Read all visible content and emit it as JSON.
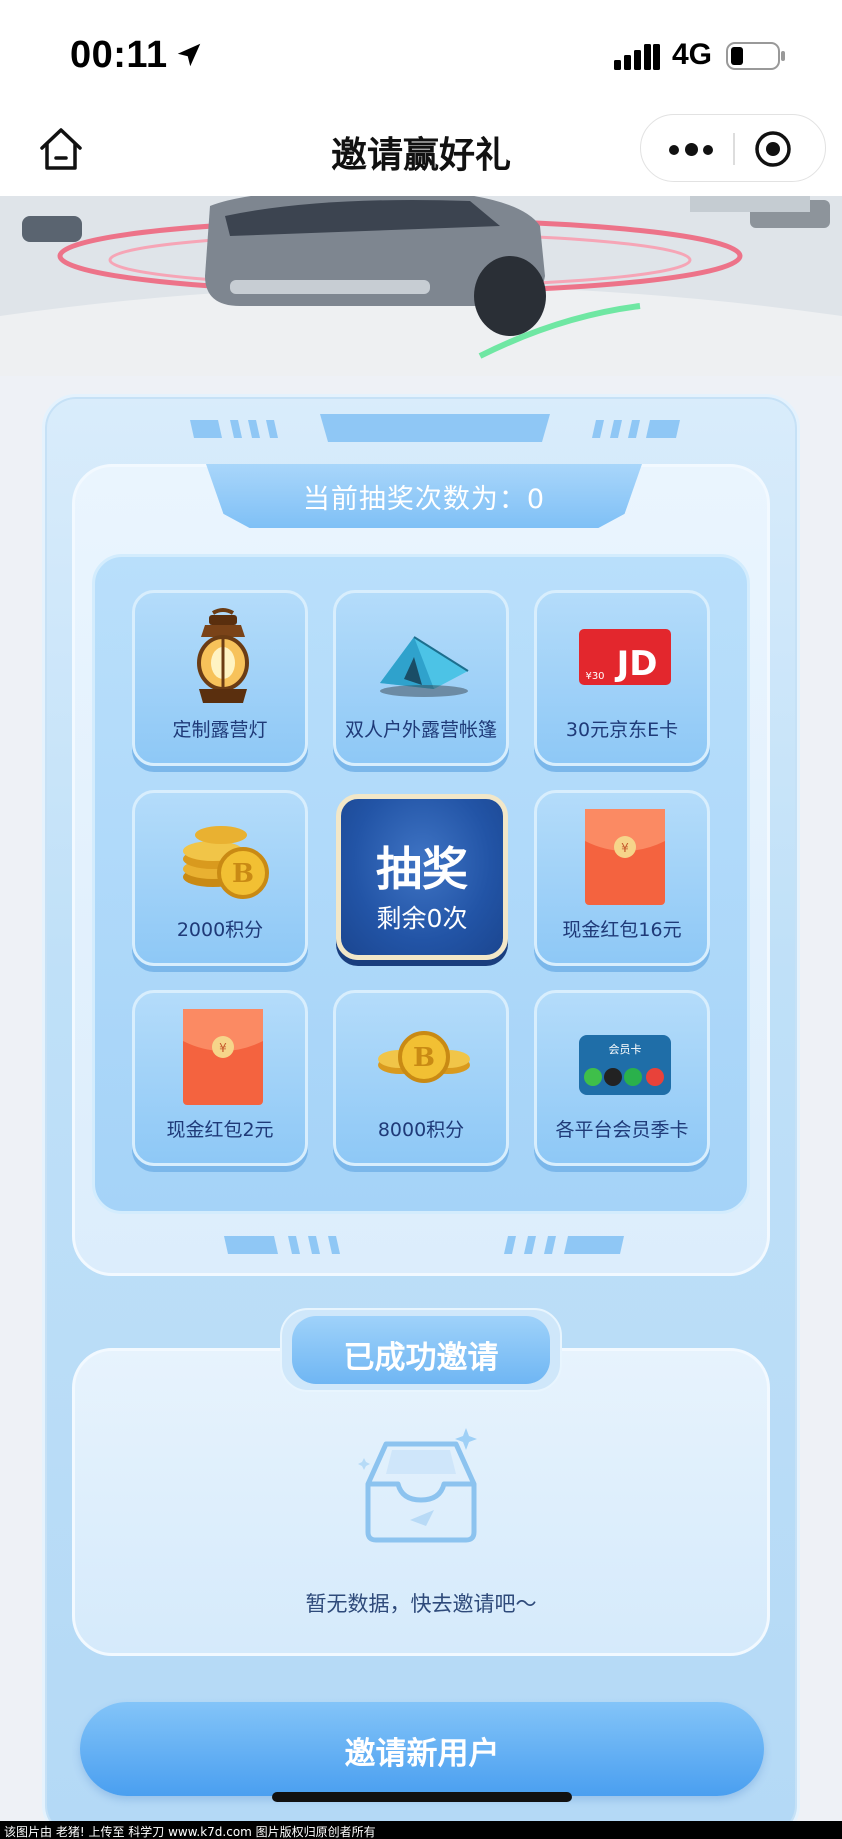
{
  "status_bar": {
    "time": "00:11",
    "network": "4G"
  },
  "nav": {
    "title": "邀请赢好礼"
  },
  "lottery": {
    "count_label": "当前抽奖次数为：0",
    "prizes": [
      {
        "name": "定制露营灯",
        "icon": "lantern-icon"
      },
      {
        "name": "双人户外露营帐篷",
        "icon": "tent-icon"
      },
      {
        "name": "30元京东E卡",
        "icon": "jd-card-icon"
      },
      {
        "name": "2000积分",
        "icon": "coins-icon"
      },
      {
        "name": "现金红包16元",
        "icon": "red-envelope-icon"
      },
      {
        "name": "现金红包2元",
        "icon": "red-envelope-icon"
      },
      {
        "name": "8000积分",
        "icon": "coins-icon"
      },
      {
        "name": "各平台会员季卡",
        "icon": "member-card-icon"
      }
    ],
    "draw_button": {
      "title": "抽奖",
      "remaining": "剩余0次"
    }
  },
  "invite": {
    "section_title": "已成功邀请",
    "empty_text": "暂无数据，快去邀请吧～",
    "button_label": "邀请新用户"
  },
  "jd_card": {
    "brand": "JD",
    "amount": "¥30"
  },
  "member_card": {
    "title": "会员卡"
  },
  "watermark": "该图片由 老猪! 上传至 科学刀 www.k7d.com 图片版权归原创者所有",
  "colors": {
    "primary": "#4a9ff0",
    "draw_button": "#2254a6",
    "frame": "#bfe0f8"
  }
}
